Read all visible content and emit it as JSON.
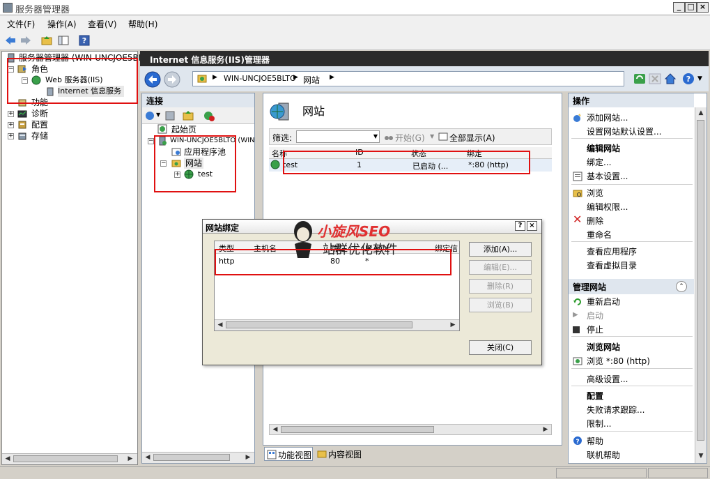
{
  "window": {
    "title": "服务器管理器"
  },
  "menu": [
    "文件(F)",
    "操作(A)",
    "查看(V)",
    "帮助(H)"
  ],
  "tree": {
    "root": "服务器管理器 (WIN-UNCJOE5BLT",
    "roles": "角色",
    "web_server": "Web 服务器(IIS)",
    "iis_manager": "Internet 信息服务",
    "features": "功能",
    "diagnostics": "诊断",
    "configuration": "配置",
    "storage": "存储"
  },
  "iis": {
    "header": "Internet 信息服务(IIS)管理器",
    "breadcrumb": [
      "WIN-UNCJOE5BLTO",
      "网站"
    ]
  },
  "connections": {
    "header": "连接",
    "start_page": "起始页",
    "server": "WIN-UNCJOE5BLTO (WIN",
    "app_pools": "应用程序池",
    "sites": "网站",
    "site_test": "test"
  },
  "main": {
    "title": "网站",
    "filter_label": "筛选:",
    "start_label": "开始(G)",
    "show_all_label": "全部显示(A)",
    "columns": [
      "名称",
      "ID",
      "状态",
      "绑定"
    ],
    "rows": [
      {
        "name": "test",
        "id": "1",
        "status": "已启动 (...",
        "binding": "*:80 (http)"
      }
    ],
    "feature_view": "功能视图",
    "content_view": "内容视图"
  },
  "actions": {
    "header": "操作",
    "add_site": "添加网站...",
    "set_defaults": "设置网站默认设置...",
    "edit_site_header": "编辑网站",
    "bindings": "绑定...",
    "basic_settings": "基本设置...",
    "explore": "浏览",
    "edit_permissions": "编辑权限...",
    "delete": "删除",
    "rename": "重命名",
    "view_apps": "查看应用程序",
    "view_vdirs": "查看虚拟目录",
    "manage_site_header": "管理网站",
    "restart": "重新启动",
    "start": "启动",
    "stop": "停止",
    "browse_site_header": "浏览网站",
    "browse_80": "浏览 *:80 (http)",
    "advanced": "高级设置...",
    "configure_header": "配置",
    "failed_tracing": "失败请求跟踪...",
    "limits": "限制...",
    "help": "帮助",
    "online_help": "联机帮助"
  },
  "dialog": {
    "title": "网站绑定",
    "columns": [
      "类型",
      "主机名",
      "端口",
      "IP 地址",
      "绑定信"
    ],
    "row": {
      "type": "http",
      "port": "80",
      "ip": "*"
    },
    "add": "添加(A)...",
    "edit": "编辑(E)...",
    "remove": "删除(R)",
    "browse": "浏览(B)",
    "close": "关闭(C)"
  },
  "watermark": {
    "brand": "小旋风SEO",
    "slogan": "站群优化软件"
  }
}
